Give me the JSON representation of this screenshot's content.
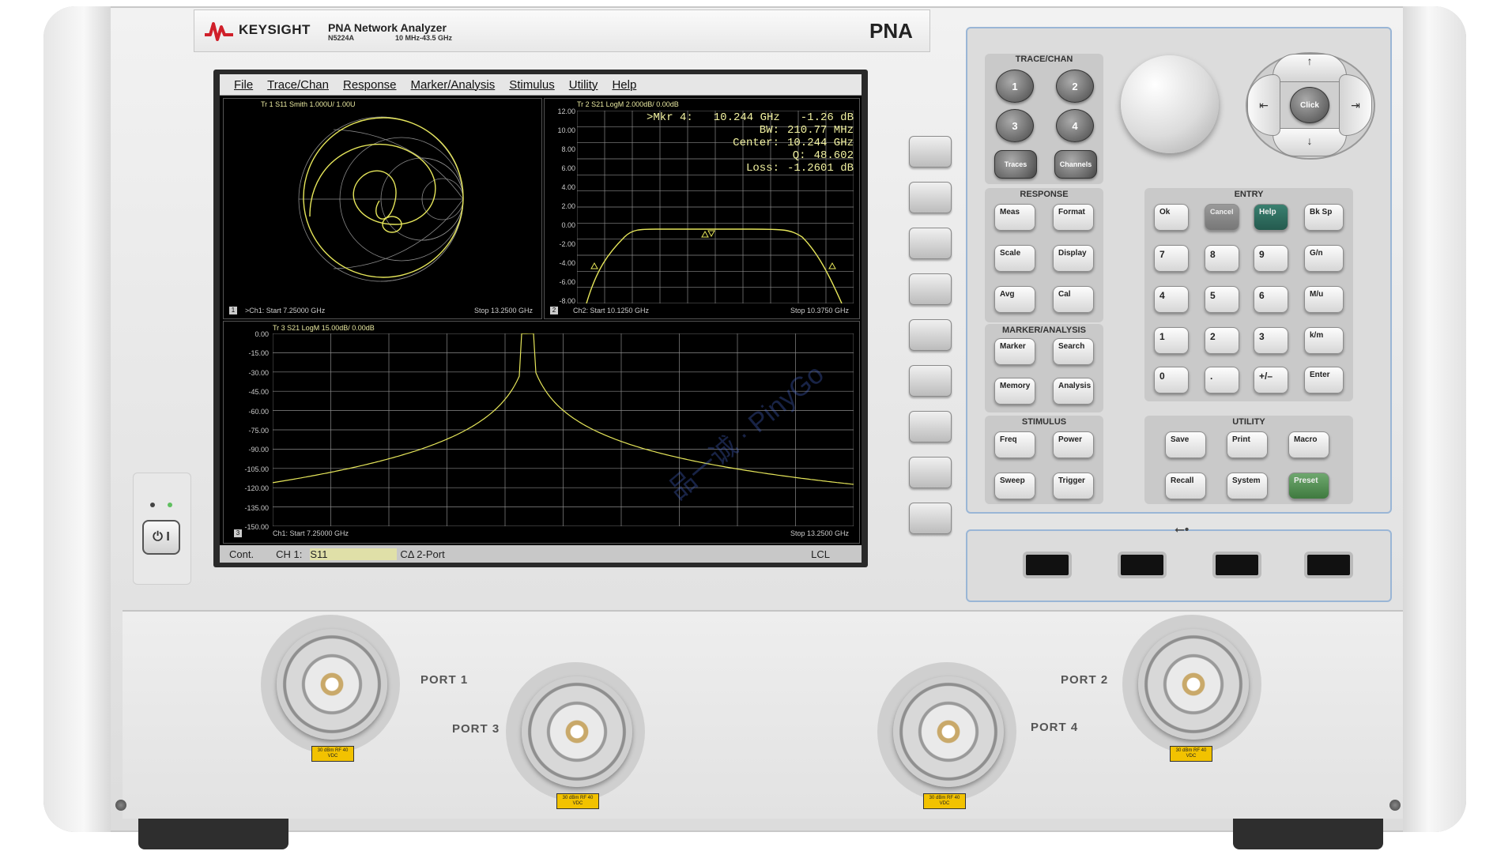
{
  "header": {
    "brand": "KEYSIGHT",
    "product": "PNA Network Analyzer",
    "model": "N5224A",
    "range": "10 MHz-43.5 GHz",
    "series": "PNA"
  },
  "menu": [
    "File",
    "Trace/Chan",
    "Response",
    "Marker/Analysis",
    "Stimulus",
    "Utility",
    "Help"
  ],
  "pane1": {
    "title": "Tr 1  S11 Smith 1.000U/ 1.00U",
    "index": "1",
    "start": ">Ch1: Start  7.25000 GHz",
    "stop": "Stop  13.2500 GHz"
  },
  "pane2": {
    "title": "Tr 2  S21 LogM 2.000dB/ 0.00dB",
    "index": "2",
    "start": "Ch2: Start  10.1250 GHz",
    "stop": "Stop  10.3750 GHz",
    "yticks": [
      "12.00",
      "10.00",
      "8.00",
      "6.00",
      "4.00",
      "2.00",
      "0.00",
      "-2.00",
      "-4.00",
      "-6.00",
      "-8.00"
    ],
    "marker": {
      "label": ">Mkr 4:",
      "freq": "10.244 GHz",
      "value": "-1.26 dB",
      "rows": [
        {
          "k": "BW:",
          "v": "210.77 MHz"
        },
        {
          "k": "Center:",
          "v": "10.244 GHz"
        },
        {
          "k": "Q:",
          "v": "48.602"
        },
        {
          "k": "Loss:",
          "v": "-1.2601 dB"
        }
      ]
    }
  },
  "pane3": {
    "title": "Tr 3  S21 LogM 15.00dB/ 0.00dB",
    "index": "3",
    "start": "Ch1: Start  7.25000 GHz",
    "stop": "Stop  13.2500 GHz",
    "yticks": [
      "0.00",
      "-15.00",
      "-30.00",
      "-45.00",
      "-60.00",
      "-75.00",
      "-90.00",
      "-105.00",
      "-120.00",
      "-135.00",
      "-150.00"
    ]
  },
  "status": {
    "mode": "Cont.",
    "channel": "CH 1:",
    "param": "S11",
    "cal": "CΔ 2-Port",
    "remote": "LCL"
  },
  "panel": {
    "trace_chan": {
      "title": "TRACE/CHAN",
      "keys": [
        "1",
        "2",
        "3",
        "4"
      ],
      "traces": "Traces",
      "channels": "Channels"
    },
    "response": {
      "title": "RESPONSE",
      "keys": [
        "Meas",
        "Format",
        "Scale",
        "Display",
        "Avg",
        "Cal"
      ]
    },
    "marker_analysis": {
      "title": "MARKER/ANALYSIS",
      "keys": [
        "Marker",
        "Search",
        "Memory",
        "Analysis"
      ]
    },
    "stimulus": {
      "title": "STIMULUS",
      "keys": [
        "Freq",
        "Power",
        "Sweep",
        "Trigger"
      ]
    },
    "entry": {
      "title": "ENTRY",
      "ok": "Ok",
      "cancel": "Cancel",
      "help": "Help",
      "bksp": "Bk Sp",
      "rows": [
        [
          "7",
          "8",
          "9",
          "G/n"
        ],
        [
          "4",
          "5",
          "6",
          "M/u"
        ],
        [
          "1",
          "2",
          "3",
          "k/m"
        ],
        [
          "0",
          ".",
          "+/–",
          "Enter"
        ]
      ]
    },
    "utility": {
      "title": "UTILITY",
      "keys": [
        "Save",
        "Print",
        "Macro",
        "Recall",
        "System",
        "Preset"
      ]
    },
    "nav": {
      "center": "Click"
    }
  },
  "ports": {
    "p1": "PORT 1",
    "p2": "PORT 2",
    "p3": "PORT 3",
    "p4": "PORT 4",
    "warn": "30 dBm RF 40 VDC"
  },
  "watermark": "品一诚 · PinyGo",
  "colors": {
    "trace": "#e6e65a",
    "grid": "#8a8a8a",
    "help_key": "#2d6c5e",
    "preset_key": "#4f8c4f",
    "cancel_key": "#8a8a8a"
  }
}
